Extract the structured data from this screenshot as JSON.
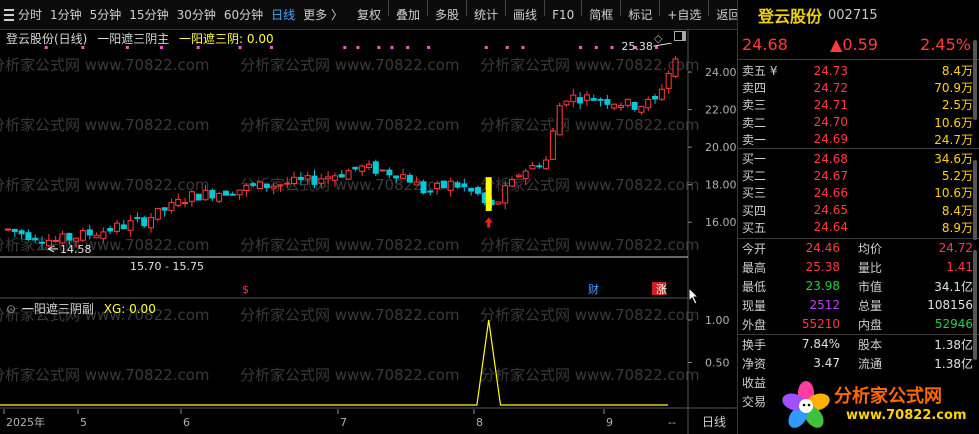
{
  "toolbar": {
    "periods": [
      "分时",
      "1分钟",
      "5分钟",
      "15分钟",
      "30分钟",
      "60分钟",
      "日线",
      "更多 〉"
    ],
    "active_period": "日线",
    "tools": [
      "复权",
      "叠加",
      "多股",
      "统计",
      "画线",
      "F10",
      "简框",
      "标记",
      "+自选",
      "返回"
    ]
  },
  "main_panel": {
    "title": "登云股份(日线)",
    "indicator_name": "一阳遮三阴主",
    "indicator_value": "一阳遮三阴: 0.00",
    "high_marker": "25.38",
    "low_marker": "14.58",
    "range_label": "15.70 - 15.75",
    "event_markers": [
      "$",
      "财",
      "涨"
    ],
    "price_ticks": [
      "24.00",
      "22.00",
      "20.00",
      "18.00",
      "16.00"
    ]
  },
  "sub_panel": {
    "title": "一阳遮三阴副",
    "indicator_value": "XG: 0.00",
    "ticks": [
      "1.00",
      "0.50"
    ]
  },
  "time_axis": {
    "labels": [
      "2025年",
      "5",
      "6",
      "7",
      "8",
      "9"
    ],
    "period_button": "日线"
  },
  "watermark": "分析家公式网 www.70822.com",
  "quote": {
    "name": "登云股份",
    "code": "002715",
    "price": "24.68",
    "change": "▲0.59",
    "change_pct": "2.45%",
    "asks": [
      {
        "label": "卖五 ¥",
        "price": "24.73",
        "volume": "8.4万"
      },
      {
        "label": "卖四",
        "price": "24.72",
        "volume": "70.9万"
      },
      {
        "label": "卖三",
        "price": "24.71",
        "volume": "2.5万"
      },
      {
        "label": "卖二",
        "price": "24.70",
        "volume": "10.6万"
      },
      {
        "label": "卖一",
        "price": "24.69",
        "volume": "24.7万"
      }
    ],
    "bids": [
      {
        "label": "买一",
        "price": "24.68",
        "volume": "34.6万"
      },
      {
        "label": "买二",
        "price": "24.67",
        "volume": "5.2万"
      },
      {
        "label": "买三",
        "price": "24.66",
        "volume": "10.6万"
      },
      {
        "label": "买四",
        "price": "24.65",
        "volume": "8.4万"
      },
      {
        "label": "买五",
        "price": "24.64",
        "volume": "8.9万"
      }
    ],
    "stats": [
      {
        "l1": "今开",
        "v1": "24.46",
        "c1": "red",
        "l2": "均价",
        "v2": "24.72",
        "c2": "red"
      },
      {
        "l1": "最高",
        "v1": "25.38",
        "c1": "red",
        "l2": "量比",
        "v2": "1.41",
        "c2": "red"
      },
      {
        "l1": "最低",
        "v1": "23.98",
        "c1": "green",
        "l2": "市值",
        "v2": "34.1亿",
        "c2": "white"
      },
      {
        "l1": "现量",
        "v1": "2512",
        "c1": "purple",
        "l2": "总量",
        "v2": "108156",
        "c2": "white"
      },
      {
        "l1": "外盘",
        "v1": "55210",
        "c1": "red",
        "l2": "内盘",
        "v2": "52946",
        "c2": "green"
      }
    ],
    "stats2": [
      {
        "l1": "换手",
        "v1": "7.84%",
        "l2": "股本",
        "v2": "1.38亿"
      },
      {
        "l1": "净资",
        "v1": "3.47",
        "l2": "流通",
        "v2": "1.38亿"
      },
      {
        "l1": "收益",
        "v1": "",
        "l2": "",
        "v2": ""
      },
      {
        "l1": "交易",
        "v1": "",
        "l2": "",
        "v2": ""
      }
    ]
  },
  "logo": {
    "name": "分析家公式网",
    "url": "www.70822.com"
  },
  "colors": {
    "up": "#ff3b3b",
    "down": "#00c8d8",
    "signal": "#ffff00",
    "title_pink": "#ff4fd8"
  }
}
